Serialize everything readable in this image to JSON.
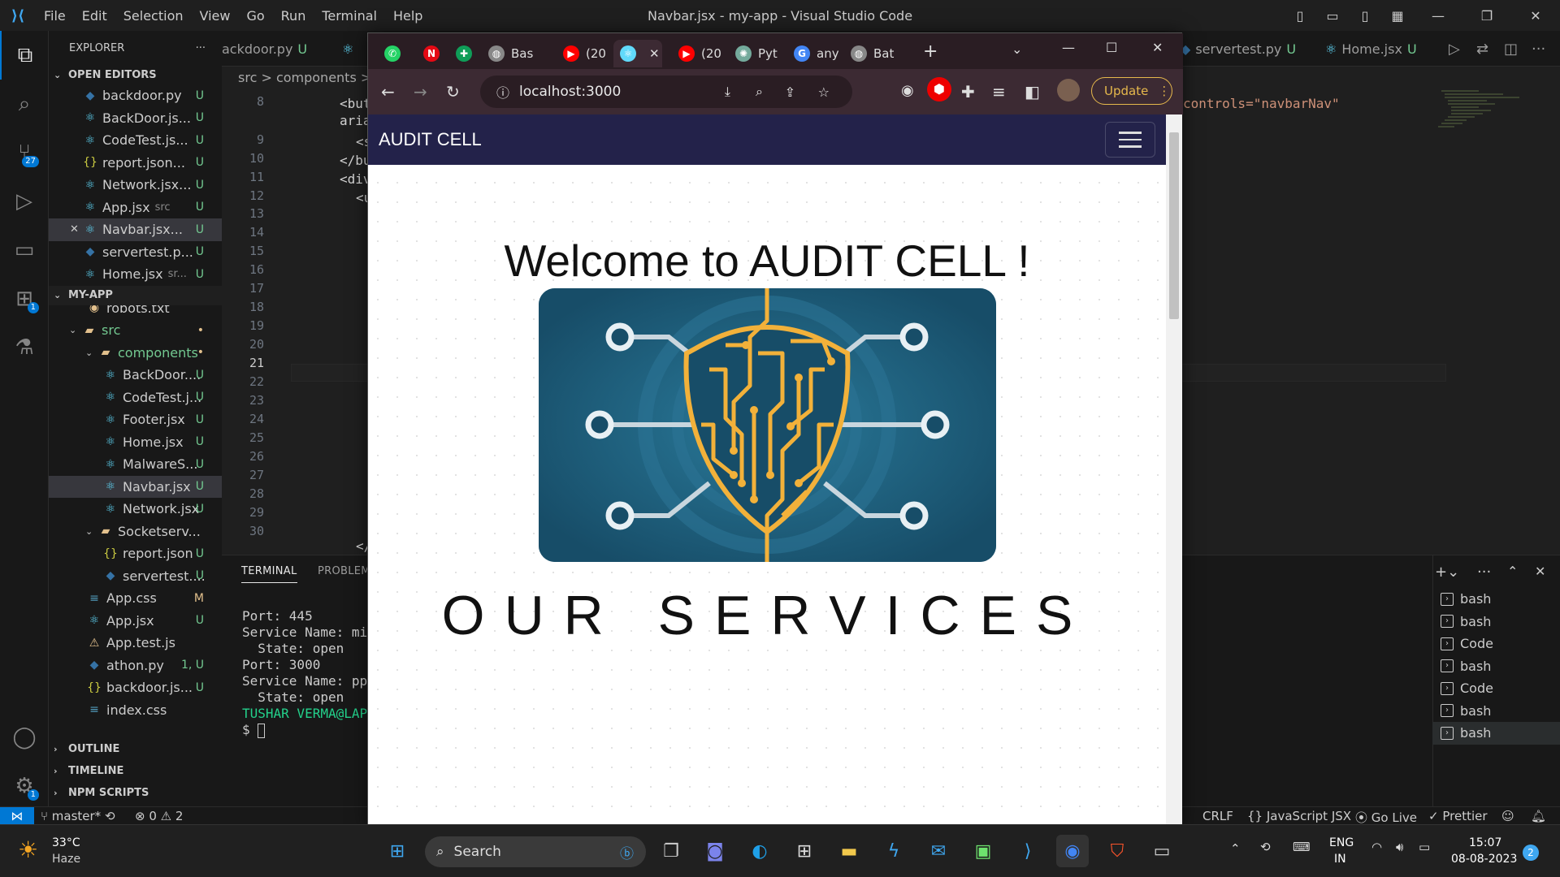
{
  "window_title": "Navbar.jsx - my-app - Visual Studio Code",
  "menu": [
    "File",
    "Edit",
    "Selection",
    "View",
    "Go",
    "Run",
    "Terminal",
    "Help"
  ],
  "explorer": {
    "title": "EXPLORER",
    "open_editors_label": "OPEN EDITORS",
    "open_editors": [
      {
        "name": "backdoor.py",
        "status": "U",
        "kind": "py"
      },
      {
        "name": "BackDoor.js...",
        "status": "U",
        "kind": "react"
      },
      {
        "name": "CodeTest.js...",
        "status": "U",
        "kind": "react"
      },
      {
        "name": "report.json...",
        "status": "U",
        "kind": "json"
      },
      {
        "name": "Network.jsx...",
        "status": "U",
        "kind": "react"
      },
      {
        "name": "App.jsx",
        "hint": "src",
        "status": "U",
        "kind": "react"
      },
      {
        "name": "Navbar.jsx...",
        "status": "U",
        "kind": "react"
      },
      {
        "name": "servertest.p...",
        "status": "U",
        "kind": "py"
      },
      {
        "name": "Home.jsx",
        "hint": "sr...",
        "status": "U",
        "kind": "react"
      }
    ],
    "project_label": "MY-APP",
    "tree": [
      {
        "name": "robots.txt",
        "depth": 2,
        "status": "",
        "kind": "txt"
      },
      {
        "name": "src",
        "depth": 1,
        "status": "•",
        "kind": "folder"
      },
      {
        "name": "components",
        "depth": 2,
        "status": "•",
        "kind": "folder"
      },
      {
        "name": "BackDoor....",
        "depth": 3,
        "status": "U",
        "kind": "react"
      },
      {
        "name": "CodeTest.j...",
        "depth": 3,
        "status": "U",
        "kind": "react"
      },
      {
        "name": "Footer.jsx",
        "depth": 3,
        "status": "U",
        "kind": "react"
      },
      {
        "name": "Home.jsx",
        "depth": 3,
        "status": "U",
        "kind": "react"
      },
      {
        "name": "MalwareS...",
        "depth": 3,
        "status": "U",
        "kind": "react"
      },
      {
        "name": "Navbar.jsx",
        "depth": 3,
        "status": "U",
        "kind": "react",
        "selected": true
      },
      {
        "name": "Network.jsx",
        "depth": 3,
        "status": "U",
        "kind": "react"
      },
      {
        "name": "Socketserv...",
        "depth": 2,
        "status": "",
        "kind": "folder"
      },
      {
        "name": "report.json",
        "depth": 3,
        "status": "U",
        "kind": "json"
      },
      {
        "name": "servertest....",
        "depth": 3,
        "status": "U",
        "kind": "py"
      },
      {
        "name": "App.css",
        "depth": 2,
        "status": "M",
        "kind": "css"
      },
      {
        "name": "App.jsx",
        "depth": 2,
        "status": "U",
        "kind": "react"
      },
      {
        "name": "App.test.js",
        "depth": 2,
        "status": "",
        "kind": "test"
      },
      {
        "name": "athon.py",
        "depth": 2,
        "status": "1, U",
        "kind": "py"
      },
      {
        "name": "backdoor.js...",
        "depth": 2,
        "status": "U",
        "kind": "json"
      },
      {
        "name": "index.css",
        "depth": 2,
        "status": "",
        "kind": "css"
      }
    ],
    "outline": "OUTLINE",
    "timeline": "TIMELINE",
    "npm": "NPM SCRIPTS"
  },
  "editor_tabs": {
    "left": [
      "ackdoor.py"
    ],
    "right": [
      "servertest.py",
      "Home.jsx"
    ]
  },
  "breadcrumb": "src > components >",
  "line_numbers": [
    "8",
    "",
    "9",
    "10",
    "11",
    "12",
    "13",
    "14",
    "15",
    "16",
    "17",
    "18",
    "19",
    "20",
    "21",
    "22",
    "23",
    "24",
    "25",
    "26",
    "27",
    "28",
    "29",
    "30"
  ],
  "code_fragments": [
    "<but",
    "aria",
    "<s",
    "</bu",
    "<div",
    "<u",
    "</"
  ],
  "code_right": "controls=\"navbarNav\"",
  "panel": {
    "tabs": [
      "TERMINAL",
      "PROBLEMS"
    ],
    "terminal_lines": [
      "Port: 445",
      "Service Name: mic",
      "  State: open",
      "",
      "Port: 3000",
      "Service Name: ppp",
      "  State: open",
      "",
      "TUSHAR VERMA@LAPT",
      "$ "
    ],
    "sessions": [
      "bash",
      "bash",
      "Code",
      "bash",
      "Code",
      "bash",
      "bash"
    ]
  },
  "status": {
    "branch": "master*",
    "errors": "0",
    "warnings": "2",
    "eol": "CRLF",
    "lang": "JavaScript JSX",
    "golive": "Go Live",
    "prettier": "Prettier"
  },
  "browser": {
    "tabs": [
      {
        "label": "",
        "icon": "whatsapp-icon",
        "color": "#25d366"
      },
      {
        "label": "",
        "icon": "netflix-icon",
        "color": "#e50914"
      },
      {
        "label": "",
        "icon": "sheets-icon",
        "color": "#0f9d58"
      },
      {
        "label": "Bas",
        "icon": "globe-icon",
        "color": "#888"
      },
      {
        "label": "(20",
        "icon": "youtube-icon",
        "color": "#ff0000"
      },
      {
        "label": "",
        "icon": "react-icon",
        "color": "#61dafb",
        "active": true
      },
      {
        "label": "(20",
        "icon": "youtube-icon",
        "color": "#ff0000"
      },
      {
        "label": "Pyt",
        "icon": "chatgpt-icon",
        "color": "#74aa9c"
      },
      {
        "label": "any",
        "icon": "google-icon",
        "color": "#4285f4"
      },
      {
        "label": "Bat",
        "icon": "globe-icon",
        "color": "#888"
      }
    ],
    "url": "localhost:3000",
    "update_label": "Update",
    "brand": "AUDIT CELL",
    "welcome": "Welcome to AUDIT CELL !",
    "services": "OUR SERVICES"
  },
  "taskbar": {
    "weather_temp": "33°C",
    "weather_desc": "Haze",
    "search": "Search",
    "lang": "ENG",
    "region": "IN",
    "time": "15:07",
    "date": "08-08-2023",
    "notif": "2"
  }
}
